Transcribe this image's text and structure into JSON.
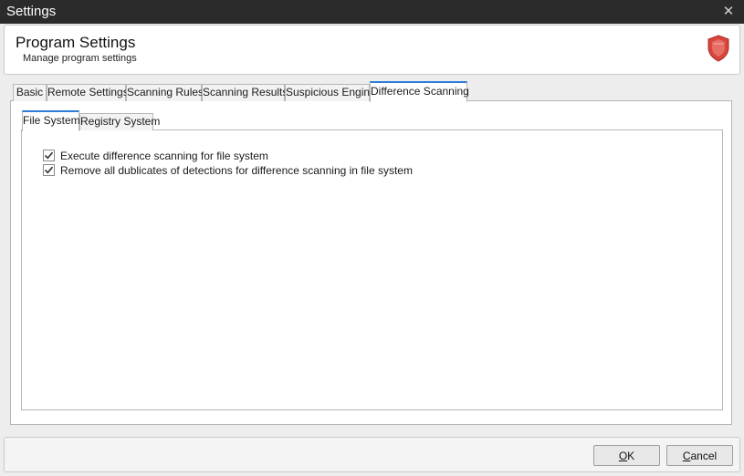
{
  "window": {
    "title": "Settings",
    "close_glyph": "✕"
  },
  "header": {
    "title": "Program Settings",
    "subtitle": "Manage program settings",
    "icon": "shield-icon",
    "icon_color": "#d9443b"
  },
  "tabs": [
    {
      "label": "Basic"
    },
    {
      "label": "Remote Settings"
    },
    {
      "label": "Scanning Rules"
    },
    {
      "label": "Scanning Results"
    },
    {
      "label": "Suspicious Engine"
    },
    {
      "label": "Difference Scanning",
      "active": true
    }
  ],
  "subtabs": [
    {
      "label": "File System",
      "active": true
    },
    {
      "label": "Registry System"
    }
  ],
  "options": [
    {
      "label": "Execute difference scanning for file system",
      "checked": true
    },
    {
      "label": "Remove all dublicates of detections for difference scanning in file system",
      "checked": true
    }
  ],
  "buttons": {
    "ok": {
      "mnemonic": "O",
      "rest": "K"
    },
    "cancel": {
      "mnemonic": "C",
      "rest": "ancel"
    }
  },
  "colors": {
    "accent": "#2e7dd7",
    "titlebar": "#2b2b2b"
  }
}
